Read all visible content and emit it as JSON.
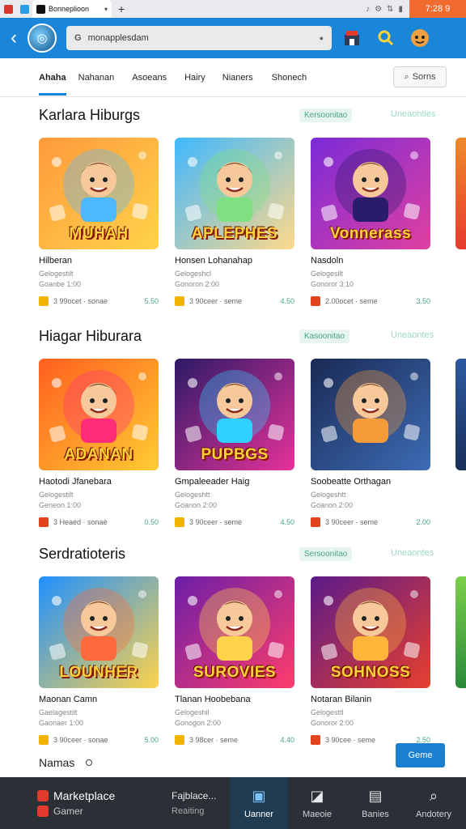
{
  "browser": {
    "tab_title": "Bonneplioon",
    "time": "7:28 9"
  },
  "header": {
    "search_placeholder": "monapplesdam",
    "search_prefix": "G"
  },
  "nav": {
    "tabs": [
      "Ahaha",
      "Nahanan",
      "Asoeans",
      "Hairy",
      "Nianers",
      "Shonech"
    ],
    "active_index": 0,
    "button_label": "Sorns"
  },
  "sections": [
    {
      "title": "Karlara Hiburgs",
      "chip": "Kersoonitao",
      "more": "Uneaonties",
      "cards": [
        {
          "caption": "MUHAH",
          "title": "Hilberan",
          "sub1": "Gelogestilt",
          "sub2": "Goanbe 1:00",
          "meta": "3 99ocet · sonae",
          "rating": "5.50",
          "icon_color": "yellow"
        },
        {
          "caption": "APLEPHES",
          "title": "Honsen Lohanahap",
          "sub1": "Gelogeshcl",
          "sub2": "Gonoron 2:00",
          "meta": "3 90ceer · seme",
          "rating": "4.50",
          "icon_color": "yellow"
        },
        {
          "caption": "Vonnerass",
          "title": "Nasdoln",
          "sub1": "Gelogesilt",
          "sub2": "Gonoror 3:10",
          "meta": "2.00ocet · seme",
          "rating": "3.50",
          "icon_color": "red"
        }
      ]
    },
    {
      "title": "Hiagar Hiburara",
      "chip": "Kasoonitao",
      "more": "Uneaontes",
      "cards": [
        {
          "caption": "ADANAN",
          "title": "Haotodi Jfanebara",
          "sub1": "Gelogestilt",
          "sub2": "Geneon 1:00",
          "meta": "3 Heaed · sonae",
          "rating": "0.50",
          "icon_color": "red"
        },
        {
          "caption": "PUPBGS",
          "title": "Gmpaleeader Haig",
          "sub1": "Gelogeshtt",
          "sub2": "Goanon 2:00",
          "meta": "3 90ceer · seme",
          "rating": "4.50",
          "icon_color": "yellow"
        },
        {
          "caption": "",
          "title": "Soobeatte Orthagan",
          "sub1": "Gelogeshtt",
          "sub2": "Goanon 2:00",
          "meta": "3 90ceer · seme",
          "rating": "2.00",
          "icon_color": "red"
        }
      ]
    },
    {
      "title": "Serdratioteris",
      "chip": "Sersoonitao",
      "more": "Uneaontes",
      "cards": [
        {
          "caption": "LOUNHER",
          "title": "Maonan Camn",
          "sub1": "Gaelagestilt",
          "sub2": "Gaonaer 1:00",
          "meta": "3 90ceer · sonae",
          "rating": "5.00",
          "icon_color": "yellow"
        },
        {
          "caption": "SUROVIES",
          "title": "Tlanan Hoobebana",
          "sub1": "Gelogeshil",
          "sub2": "Gonogon 2:00",
          "meta": "3 98cer · seme",
          "rating": "4.40",
          "icon_color": "yellow"
        },
        {
          "caption": "SOHNOSS",
          "title": "Notaran Bilanin",
          "sub1": "Gelogesttl",
          "sub2": "Gonoror 2:00",
          "meta": "3 90cee · seme",
          "rating": "2.50",
          "icon_color": "red"
        }
      ]
    }
  ],
  "footer": {
    "label": "Namas",
    "float_button": "Geme"
  },
  "bottom_nav": {
    "market_title": "Marketplace",
    "market_sub": "Gamer",
    "first": {
      "label_top": "Fajblace...",
      "label_bottom": "Reaiting"
    },
    "items": [
      {
        "label": "Uanner",
        "icon": "photo-icon",
        "active": true
      },
      {
        "label": "Maeoie",
        "icon": "image-icon",
        "active": false
      },
      {
        "label": "Banies",
        "icon": "document-icon",
        "active": false
      },
      {
        "label": "Andotery",
        "icon": "search-icon",
        "active": false
      }
    ]
  }
}
